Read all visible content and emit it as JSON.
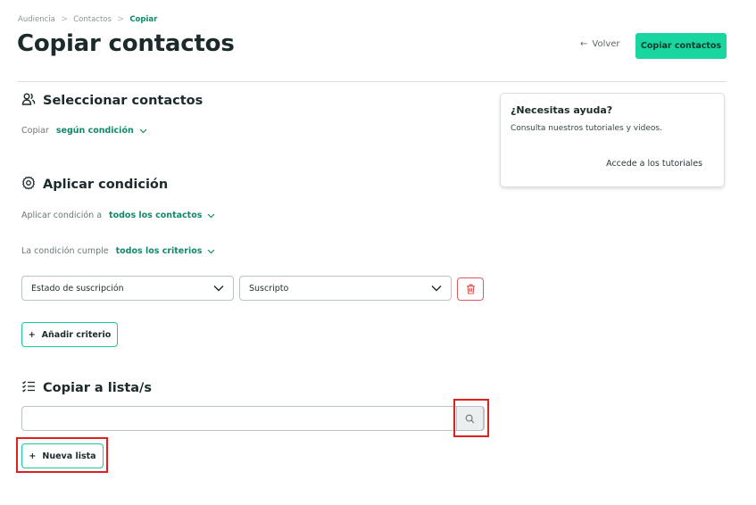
{
  "breadcrumb": {
    "items": [
      "Audiencia",
      "Contactos",
      "Copiar"
    ],
    "separator": ">"
  },
  "header": {
    "title": "Copiar contactos",
    "back_label": "Volver",
    "primary_button_label": "Copiar contactos"
  },
  "select_contacts": {
    "title": "Seleccionar contactos",
    "copy_label": "Copiar",
    "copy_value": "según condición"
  },
  "apply_condition": {
    "title": "Aplicar condición",
    "apply_to_label": "Aplicar condición a",
    "apply_to_value": "todos los contactos",
    "match_label": "La condición cumple",
    "match_value": "todos los criterios",
    "criterion": {
      "field_value": "Estado de suscripción",
      "status_value": "Suscripto"
    },
    "add_criterion_label": "Añadir criterio"
  },
  "copy_to_lists": {
    "title": "Copiar a lista/s",
    "search_value": "",
    "search_placeholder": "",
    "new_list_label": "Nueva lista"
  },
  "help": {
    "title": "¿Necesitas ayuda?",
    "text": "Consulta nuestros tutoriales y videos.",
    "link_label": "Accede a los tutoriales"
  },
  "colors": {
    "accent": "#19d6a0",
    "accent_text": "#0f8a6a",
    "danger": "#e05a5a",
    "highlight": "#e02020"
  },
  "icons": {
    "select_contacts": "users-icon",
    "apply_condition": "gear-icon",
    "copy_to_lists": "checklist-icon",
    "search": "search-icon",
    "delete": "trash-icon"
  }
}
